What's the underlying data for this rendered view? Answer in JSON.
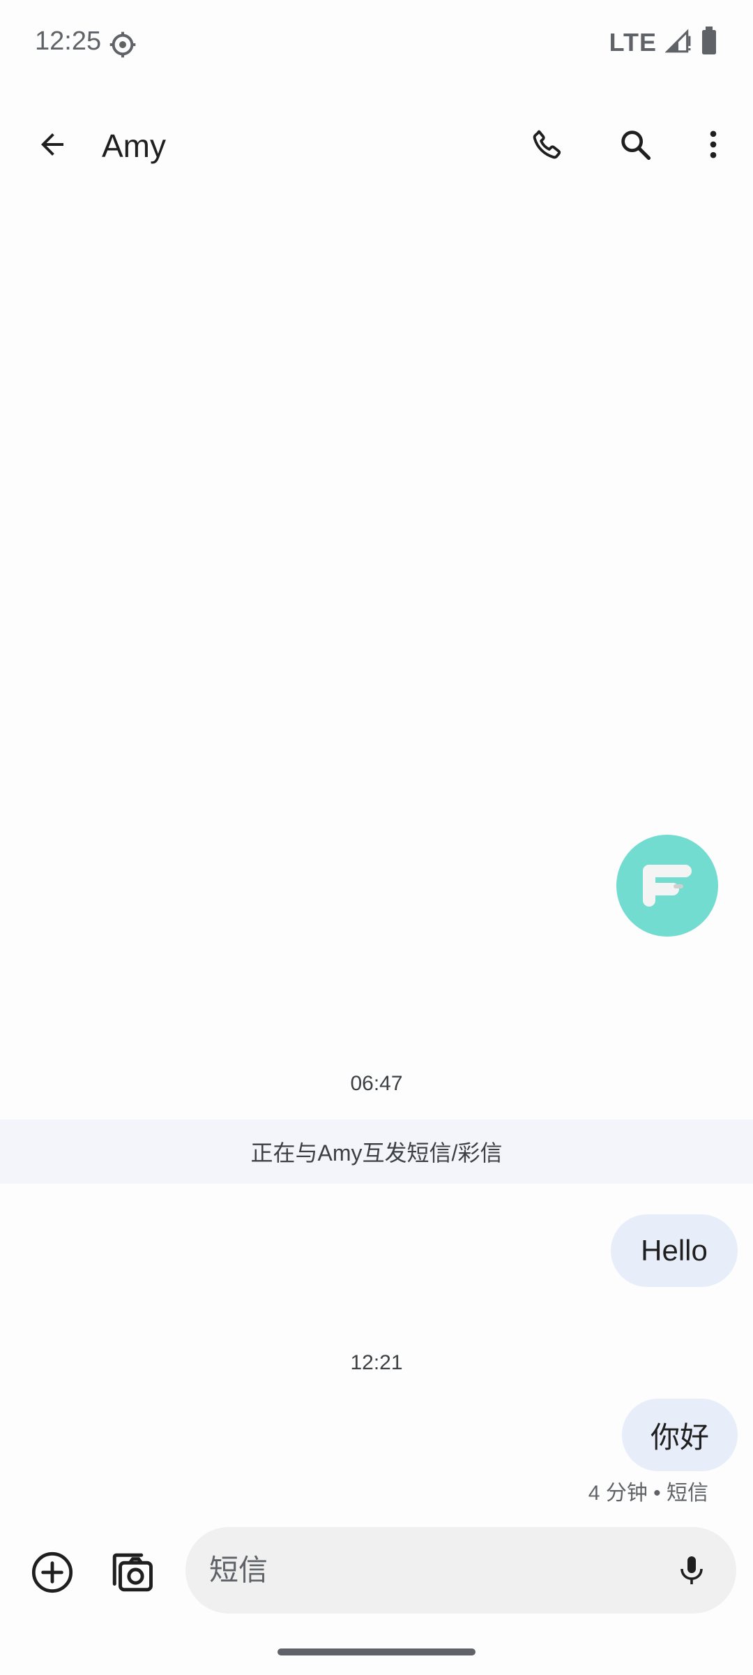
{
  "status_bar": {
    "time": "12:25",
    "network": "LTE"
  },
  "app_bar": {
    "title": "Amy"
  },
  "conversation": {
    "timestamps": [
      "06:47",
      "12:21"
    ],
    "banner": "正在与Amy互发短信/彩信",
    "messages": [
      {
        "text": "Hello"
      },
      {
        "text": "你好",
        "meta": "4 分钟 • 短信"
      }
    ]
  },
  "compose": {
    "placeholder": "短信"
  },
  "colors": {
    "accent_bubble": "#e8edfa",
    "float_button": "#71dccf"
  }
}
